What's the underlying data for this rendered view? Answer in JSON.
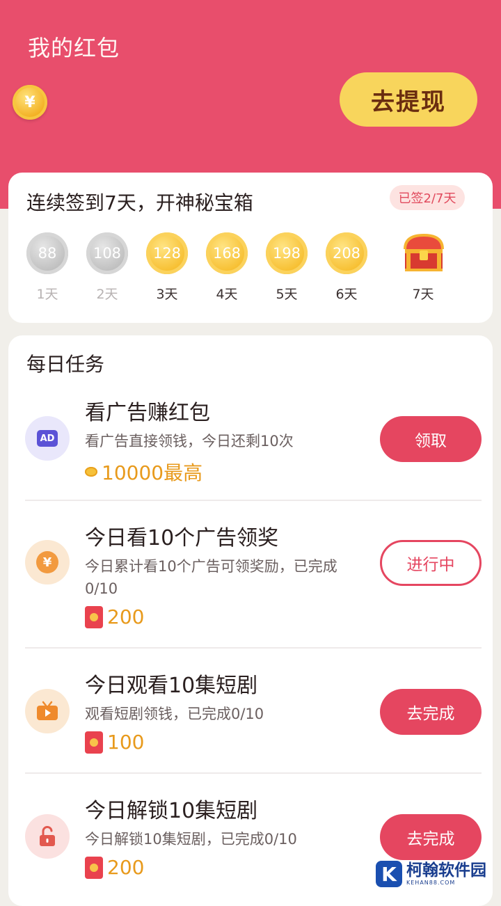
{
  "header": {
    "title": "我的红包",
    "coin_symbol": "¥",
    "withdraw_label": "去提现",
    "bg_color": "#e84e6c"
  },
  "checkin": {
    "title": "连续签到7天，开神秘宝箱",
    "badge": "已签2/7天",
    "days": [
      {
        "amount": "88",
        "label": "1天",
        "state": "past"
      },
      {
        "amount": "108",
        "label": "2天",
        "state": "past"
      },
      {
        "amount": "128",
        "label": "3天",
        "state": "future"
      },
      {
        "amount": "168",
        "label": "4天",
        "state": "future"
      },
      {
        "amount": "198",
        "label": "5天",
        "state": "future"
      },
      {
        "amount": "208",
        "label": "6天",
        "state": "future"
      },
      {
        "amount": "",
        "label": "7天",
        "state": "chest"
      }
    ]
  },
  "tasks": {
    "title": "每日任务",
    "items": [
      {
        "icon": "ad-icon",
        "title": "看广告赚红包",
        "desc": "看广告直接领钱，今日还剩10次",
        "reward": "10000最高",
        "button": "领取"
      },
      {
        "icon": "yuan-coin-icon",
        "title": "今日看10个广告领奖",
        "desc": "今日累计看10个广告可领奖励，已完成0/10",
        "reward": "200",
        "button": "进行中"
      },
      {
        "icon": "tv-play-icon",
        "title": "今日观看10集短剧",
        "desc": "观看短剧领钱，已完成0/10",
        "reward": "100",
        "button": "去完成"
      },
      {
        "icon": "unlock-icon",
        "title": "今日解锁10集短剧",
        "desc": "今日解锁10集短剧，已完成0/10",
        "reward": "200",
        "button": "去完成"
      }
    ]
  },
  "watermark": {
    "logo_letter": "K",
    "name": "柯翰软件园",
    "domain": "KEHAN88.COM"
  },
  "colors": {
    "accent": "#e54660",
    "gold": "#f7c033",
    "reward_text": "#e89a1c"
  }
}
